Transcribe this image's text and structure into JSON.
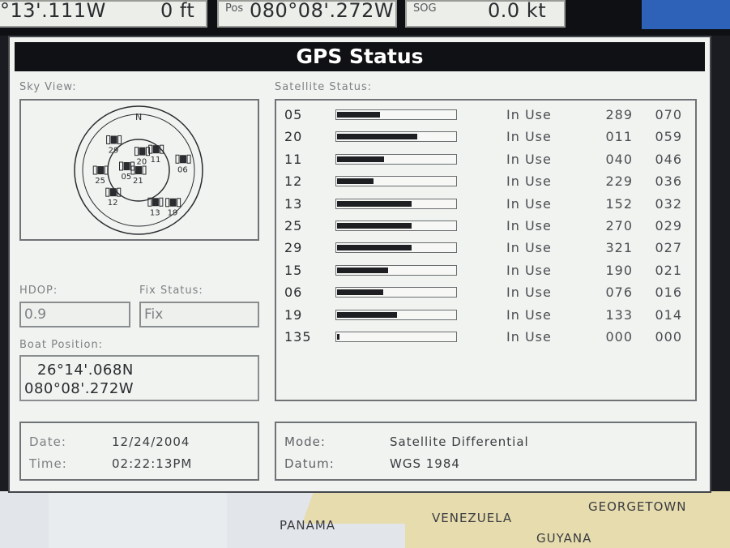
{
  "top_bar": {
    "lat_value": "°13'.111W",
    "depth_value": "0 ft",
    "pos_label": "Pos",
    "pos_value": "080°08'.272W",
    "sog_label": "SOG",
    "sog_value": "0.0 kt"
  },
  "window": {
    "title": "GPS Status"
  },
  "sky_view": {
    "label": "Sky View:",
    "north_label": "N",
    "satellites": [
      {
        "id": "21"
      },
      {
        "id": "20"
      },
      {
        "id": "11"
      },
      {
        "id": "06"
      },
      {
        "id": "05"
      },
      {
        "id": "25"
      },
      {
        "id": "12"
      },
      {
        "id": "13"
      },
      {
        "id": "19"
      },
      {
        "id": "29"
      }
    ]
  },
  "satellite_status": {
    "label": "Satellite Status:",
    "rows": [
      {
        "id": "05",
        "signal": 0.36,
        "status": "In Use",
        "azimuth": "289",
        "elevation": "070"
      },
      {
        "id": "20",
        "signal": 0.68,
        "status": "In Use",
        "azimuth": "011",
        "elevation": "059"
      },
      {
        "id": "11",
        "signal": 0.4,
        "status": "In Use",
        "azimuth": "040",
        "elevation": "046"
      },
      {
        "id": "12",
        "signal": 0.31,
        "status": "In Use",
        "azimuth": "229",
        "elevation": "036"
      },
      {
        "id": "13",
        "signal": 0.63,
        "status": "In Use",
        "azimuth": "152",
        "elevation": "032"
      },
      {
        "id": "25",
        "signal": 0.63,
        "status": "In Use",
        "azimuth": "270",
        "elevation": "029"
      },
      {
        "id": "29",
        "signal": 0.63,
        "status": "In Use",
        "azimuth": "321",
        "elevation": "027"
      },
      {
        "id": "15",
        "signal": 0.43,
        "status": "In Use",
        "azimuth": "190",
        "elevation": "021"
      },
      {
        "id": "06",
        "signal": 0.39,
        "status": "In Use",
        "azimuth": "076",
        "elevation": "016"
      },
      {
        "id": "19",
        "signal": 0.51,
        "status": "In Use",
        "azimuth": "133",
        "elevation": "014"
      },
      {
        "id": "135",
        "signal": 0.02,
        "status": "In Use",
        "azimuth": "000",
        "elevation": "000"
      }
    ]
  },
  "hdop": {
    "label": "HDOP:",
    "value": "0.9"
  },
  "fix_status": {
    "label": "Fix Status:",
    "value": "Fix"
  },
  "boat_position": {
    "label": "Boat Position:",
    "lat": "26°14'.068N",
    "lon": "080°08'.272W"
  },
  "date_time": {
    "date_label": "Date:",
    "date_value": "12/24/2004",
    "time_label": "Time:",
    "time_value": "02:22:13PM"
  },
  "mode_datum": {
    "mode_label": "Mode:",
    "mode_value": "Satellite Differential",
    "datum_label": "Datum:",
    "datum_value": "WGS 1984"
  },
  "map": {
    "labels": [
      "PANAMA",
      "VENEZUELA",
      "GEORGETOWN",
      "GUYANA"
    ]
  },
  "colors": {
    "title_bar": "#101114",
    "panel": "#f1f3f0",
    "signal_fill": "#1d1f23",
    "blue_block": "#2d62b8"
  }
}
